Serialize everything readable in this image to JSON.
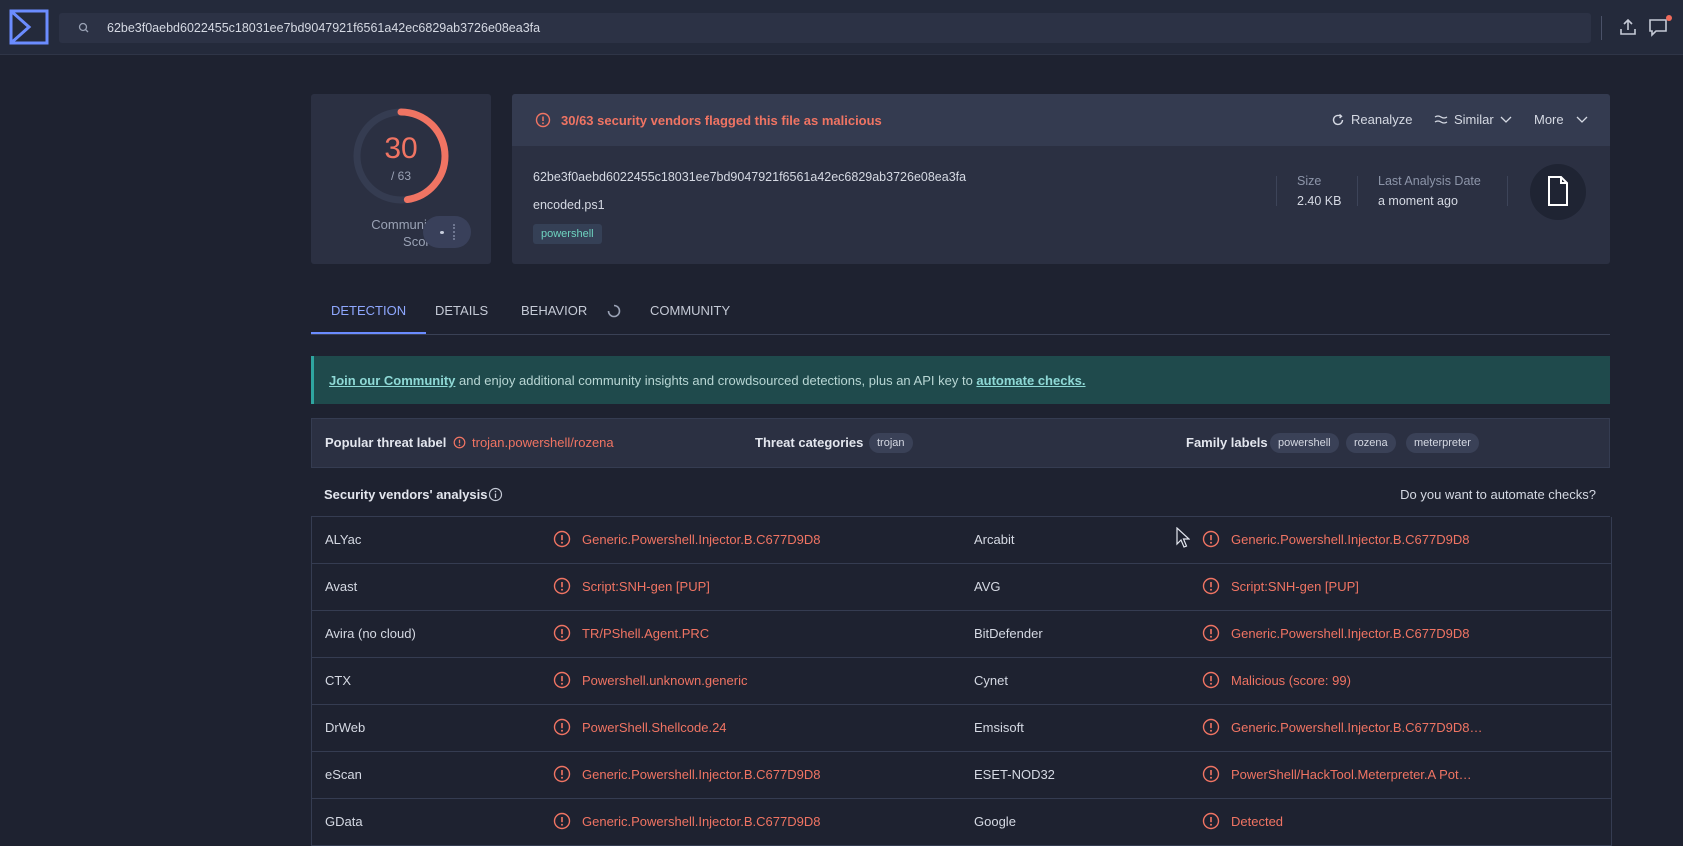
{
  "search": {
    "query": "62be3f0aebd6022455c18031ee7bd9047921f6561a42ec6829ab3726e08ea3fa"
  },
  "score": {
    "detections": "30",
    "total": "/ 63",
    "ratio": 0.476,
    "community_label": "Community Score"
  },
  "summary": {
    "flag_text": "30/63 security vendors flagged this file as malicious",
    "actions": {
      "reanalyze": "Reanalyze",
      "similar": "Similar",
      "more": "More"
    },
    "hash": "62be3f0aebd6022455c18031ee7bd9047921f6561a42ec6829ab3726e08ea3fa",
    "filename": "encoded.ps1",
    "tag": "powershell",
    "size_label": "Size",
    "size_value": "2.40 KB",
    "date_label": "Last Analysis Date",
    "date_value": "a moment ago"
  },
  "tabs": [
    "DETECTION",
    "DETAILS",
    "BEHAVIOR",
    "COMMUNITY"
  ],
  "banner": {
    "link1": "Join our Community",
    "middle": " and enjoy additional community insights and crowdsourced detections, plus an API key to ",
    "link2": "automate checks."
  },
  "threat": {
    "popular_label": "Popular threat label",
    "popular_value": "trojan.powershell/rozena",
    "categories_label": "Threat categories",
    "categories": [
      "trojan"
    ],
    "family_label": "Family labels",
    "families": [
      "powershell",
      "rozena",
      "meterpreter"
    ]
  },
  "vendors": {
    "title": "Security vendors' analysis",
    "automate": "Do you want to automate checks?",
    "rows": [
      {
        "left_name": "ALYac",
        "left_result": "Generic.Powershell.Injector.B.C677D9D8",
        "right_name": "Arcabit",
        "right_result": "Generic.Powershell.Injector.B.C677D9D8"
      },
      {
        "left_name": "Avast",
        "left_result": "Script:SNH-gen [PUP]",
        "right_name": "AVG",
        "right_result": "Script:SNH-gen [PUP]"
      },
      {
        "left_name": "Avira (no cloud)",
        "left_result": "TR/PShell.Agent.PRC",
        "right_name": "BitDefender",
        "right_result": "Generic.Powershell.Injector.B.C677D9D8"
      },
      {
        "left_name": "CTX",
        "left_result": "Powershell.unknown.generic",
        "right_name": "Cynet",
        "right_result": "Malicious (score: 99)"
      },
      {
        "left_name": "DrWeb",
        "left_result": "PowerShell.Shellcode.24",
        "right_name": "Emsisoft",
        "right_result": "Generic.Powershell.Injector.B.C677D9D8…"
      },
      {
        "left_name": "eScan",
        "left_result": "Generic.Powershell.Injector.B.C677D9D8",
        "right_name": "ESET-NOD32",
        "right_result": "PowerShell/HackTool.Meterpreter.A Pot…"
      },
      {
        "left_name": "GData",
        "left_result": "Generic.Powershell.Injector.B.C677D9D8",
        "right_name": "Google",
        "right_result": "Detected"
      }
    ]
  },
  "colors": {
    "malicious": "#f07463",
    "accent": "#6b8cff",
    "banner": "#1f4a4c"
  }
}
